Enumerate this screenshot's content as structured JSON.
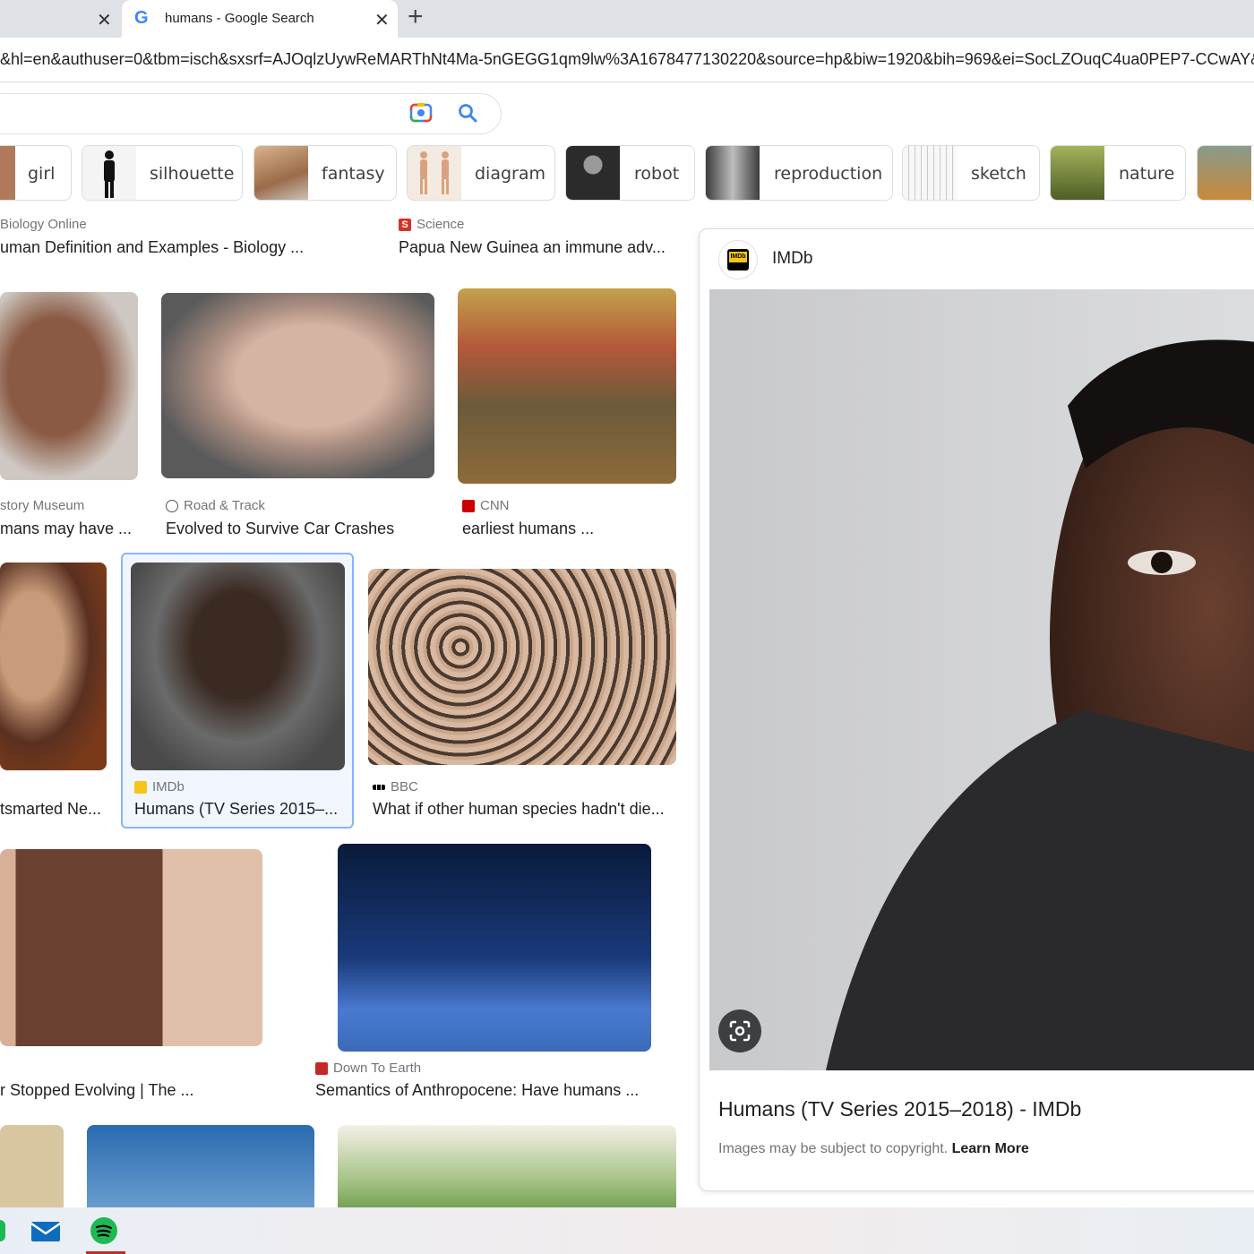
{
  "tabs": {
    "prev_close": "✕",
    "active_title": "humans - Google Search",
    "active_close": "✕",
    "new_tab": "+"
  },
  "address": {
    "url": "&hl=en&authuser=0&tbm=isch&sxsrf=AJOqlzUywReMARThNt4Ma-5nGEGG1qm9lw%3A1678477130220&source=hp&biw=1920&bih=969&ei=SocLZOuqC4ua0PEP7-CCwAY&"
  },
  "chips": [
    {
      "label": "girl",
      "color": "#b07a5a"
    },
    {
      "label": "silhouette",
      "color": "#f4f4f4"
    },
    {
      "label": "fantasy",
      "color": "#c9a27e"
    },
    {
      "label": "diagram",
      "color": "#e7d6c6"
    },
    {
      "label": "robot",
      "color": "#2b2b2b"
    },
    {
      "label": "reproduction",
      "color": "#6e6e6e"
    },
    {
      "label": "sketch",
      "color": "#eeeeee"
    },
    {
      "label": "nature",
      "color": "#6b7a3c"
    }
  ],
  "results": {
    "r1a": {
      "source": "Biology Online",
      "title": "uman Definition and Examples - Biology ..."
    },
    "r1b": {
      "source": "Science",
      "title": "Papua New Guinea an immune adv..."
    },
    "r2a": {
      "source": "story Museum",
      "title": "mans may have ..."
    },
    "r2b": {
      "source": "Road & Track",
      "title": "Evolved to Survive Car Crashes"
    },
    "r2c": {
      "source": "CNN",
      "title": "earliest humans ..."
    },
    "r3a": {
      "source": "",
      "title": "tsmarted Ne..."
    },
    "r3b": {
      "source": "IMDb",
      "title": "Humans (TV Series 2015–..."
    },
    "r3c": {
      "source": "BBC",
      "title": "What if other human species hadn't die..."
    },
    "r4a": {
      "source": "",
      "title": "r Stopped Evolving | The ..."
    },
    "r4b": {
      "source": "Down To Earth",
      "title": "Semantics of Anthropocene: Have humans ..."
    }
  },
  "panel": {
    "source": "IMDb",
    "logo_text": "IMDb",
    "title": "Humans (TV Series 2015–2018) - IMDb",
    "copyright": "Images may be subject to copyright. ",
    "learn_more": "Learn More"
  },
  "colors": {
    "accent_blue": "#4285f4",
    "selected_border": "#8ab4f8",
    "imdb_yellow": "#f5c518",
    "science_red": "#d93025",
    "cnn_red": "#cc0000",
    "dte_red": "#c62828",
    "spotify_green": "#1db954"
  }
}
